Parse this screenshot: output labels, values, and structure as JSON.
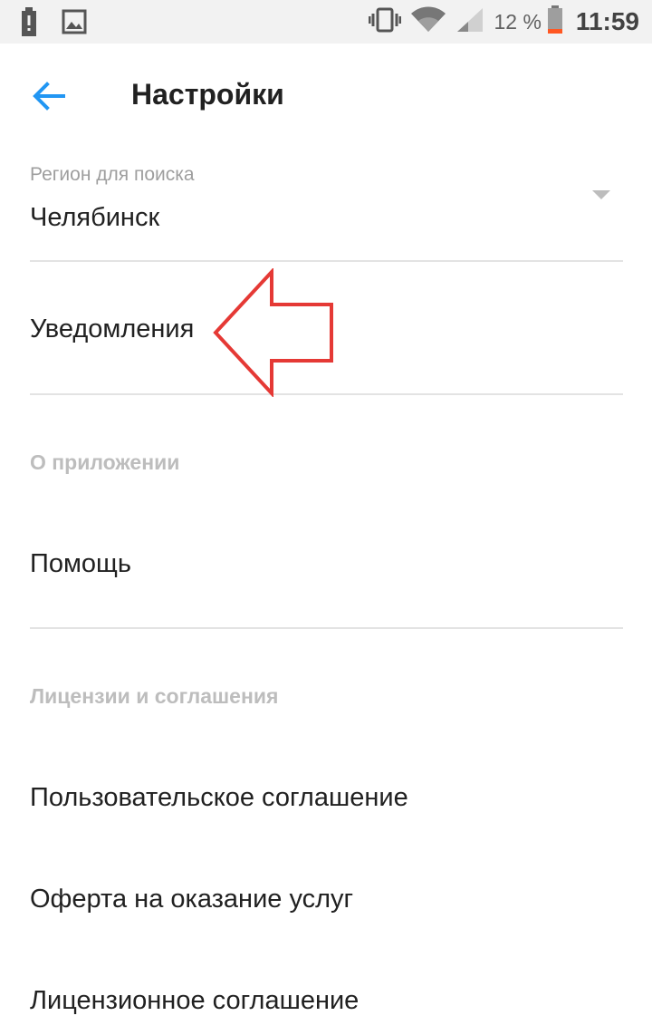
{
  "status_bar": {
    "battery_percent": "12 %",
    "time": "11:59"
  },
  "header": {
    "title": "Настройки"
  },
  "region": {
    "label": "Регион для поиска",
    "value": "Челябинск"
  },
  "items": {
    "notifications": "Уведомления",
    "help": "Помощь",
    "user_agreement": "Пользовательское соглашение",
    "offer": "Оферта на оказание услуг",
    "license_agreement": "Лицензионное соглашение"
  },
  "sections": {
    "about": "О приложении",
    "licenses": "Лицензии и соглашения"
  },
  "colors": {
    "accent": "#2196f3",
    "annotation": "#e53935"
  }
}
